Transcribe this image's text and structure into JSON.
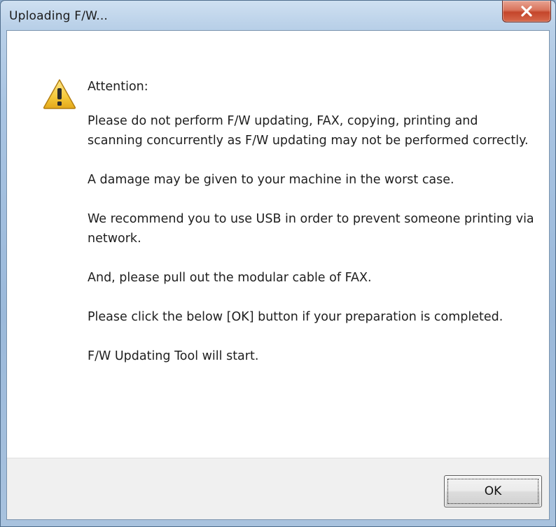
{
  "window": {
    "title": "Uploading F/W...",
    "close_icon": "close-icon"
  },
  "message": {
    "icon": "warning-icon",
    "heading": "Attention:",
    "paragraphs": [
      "Please do not perform F/W updating, FAX, copying, printing and scanning concurrently as F/W updating may not be performed correctly.",
      "A damage may be given to your machine in the worst case.",
      "We recommend you to use USB in order to prevent someone printing via network.",
      "And, please pull out the modular cable of FAX.",
      "Please click the below [OK] button if your preparation is completed.",
      "F/W Updating Tool will start."
    ]
  },
  "buttons": {
    "ok_label": "OK"
  },
  "colors": {
    "warning_fill": "#f5c93a",
    "close_button": "#c4462b"
  }
}
